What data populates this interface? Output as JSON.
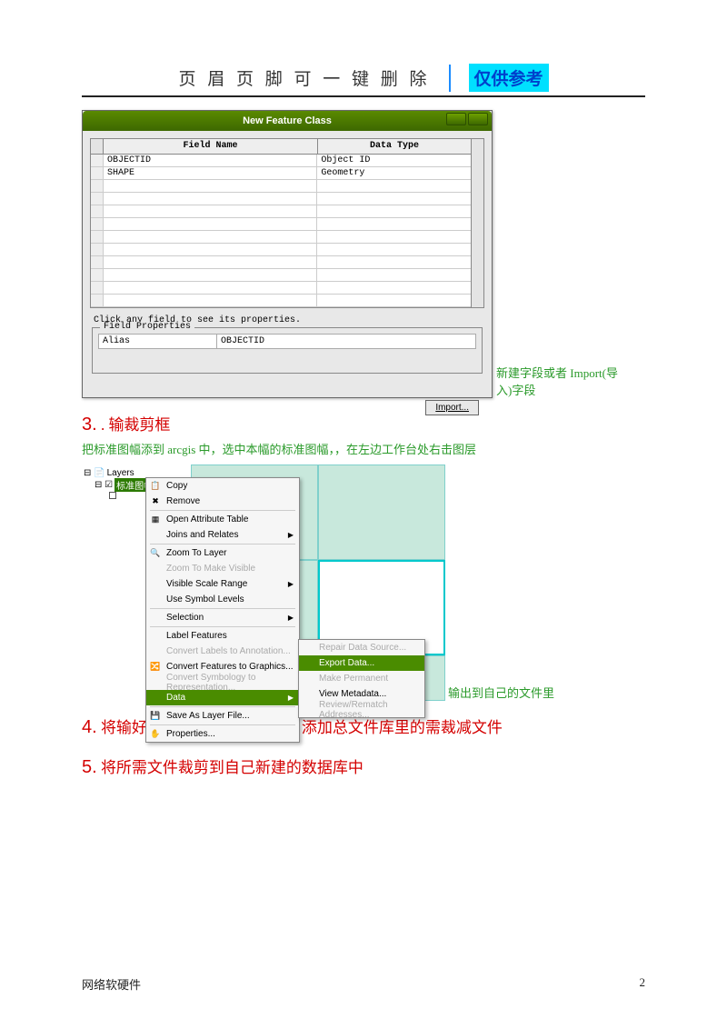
{
  "header": {
    "title": "页 眉 页 脚 可 一 键 删 除",
    "badge": "仅供参考"
  },
  "dialog": {
    "title": "New Feature Class",
    "columns": {
      "field_name": "Field Name",
      "data_type": "Data Type"
    },
    "rows": [
      {
        "name": "OBJECTID",
        "type": "Object ID"
      },
      {
        "name": "SHAPE",
        "type": "Geometry"
      }
    ],
    "hint": "Click any field to see its properties.",
    "props_legend": "Field Properties",
    "props": {
      "key": "Alias",
      "value": "OBJECTID"
    },
    "import_btn": "Import..."
  },
  "annot": {
    "import": "新建字段或者 Import(导入)字段",
    "export": "输出到自己的文件里"
  },
  "sections": {
    "s3_num": "3.",
    "s3_text": " . 输裁剪框",
    "s3_sub": "把标准图幅添到 arcgis 中，选中本幅的标准图幅，，在左边工作台处右击图层",
    "s4_num": "4.",
    "s4_text": " 将输好的裁剪框添到工程里，添加总文件库里的需裁减文件",
    "s5_num": "5.",
    "s5_text": " 将所需文件裁剪到自己新建的数据库中"
  },
  "toc": {
    "layers": "Layers"
  },
  "ctx": {
    "items": [
      "Copy",
      "Remove",
      "Open Attribute Table",
      "Joins and Relates",
      "Zoom To Layer",
      "Zoom To Make Visible",
      "Visible Scale Range",
      "Use Symbol Levels",
      "Selection",
      "Label Features",
      "Convert Labels to Annotation...",
      "Convert Features to Graphics...",
      "Convert Symbology to Representation...",
      "Data",
      "Save As Layer File...",
      "Properties..."
    ],
    "sub": [
      "Repair Data Source...",
      "Export Data...",
      "Make Permanent",
      "View Metadata...",
      "Review/Rematch Addresses..."
    ]
  },
  "footer": {
    "left": "网络软硬件",
    "right": "2"
  }
}
